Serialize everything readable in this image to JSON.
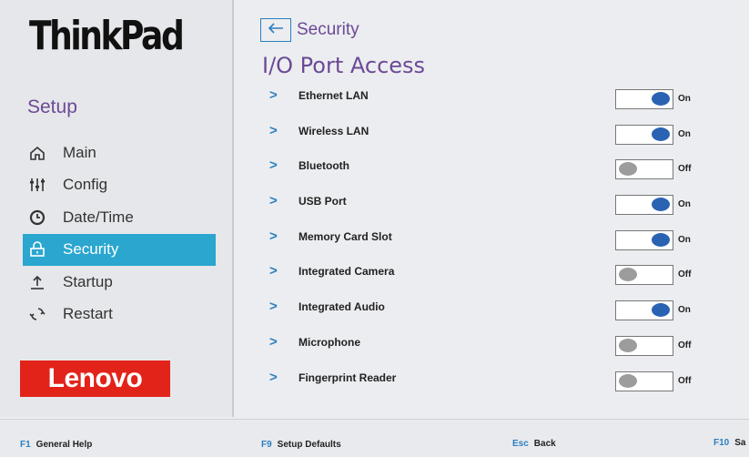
{
  "brand": {
    "model": "ThinkPad",
    "vendor": "Lenovo"
  },
  "sidebar": {
    "title": "Setup",
    "items": [
      {
        "label": "Main",
        "icon": "home-icon",
        "active": false
      },
      {
        "label": "Config",
        "icon": "sliders-icon",
        "active": false
      },
      {
        "label": "Date/Time",
        "icon": "clock-icon",
        "active": false
      },
      {
        "label": "Security",
        "icon": "lock-icon",
        "active": true
      },
      {
        "label": "Startup",
        "icon": "upload-icon",
        "active": false
      },
      {
        "label": "Restart",
        "icon": "restart-icon",
        "active": false
      }
    ]
  },
  "header": {
    "breadcrumb": "Security",
    "title": "I/O Port Access"
  },
  "ports": [
    {
      "label": "Ethernet LAN",
      "state": "On"
    },
    {
      "label": "Wireless LAN",
      "state": "On"
    },
    {
      "label": "Bluetooth",
      "state": "Off"
    },
    {
      "label": "USB Port",
      "state": "On"
    },
    {
      "label": "Memory Card Slot",
      "state": "On"
    },
    {
      "label": "Integrated Camera",
      "state": "Off"
    },
    {
      "label": "Integrated Audio",
      "state": "On"
    },
    {
      "label": "Microphone",
      "state": "Off"
    },
    {
      "label": "Fingerprint Reader",
      "state": "Off"
    }
  ],
  "footer": [
    {
      "key": "F1",
      "desc": "General Help"
    },
    {
      "key": "F9",
      "desc": "Setup Defaults"
    },
    {
      "key": "Esc",
      "desc": "Back"
    },
    {
      "key": "F10",
      "desc": "Sa"
    }
  ],
  "colors": {
    "accent": "#2aa6cf",
    "title": "#6b4a96",
    "toggle_on": "#2b63b3",
    "toggle_off": "#9c9c9c",
    "lenovo_red": "#e2231a"
  }
}
